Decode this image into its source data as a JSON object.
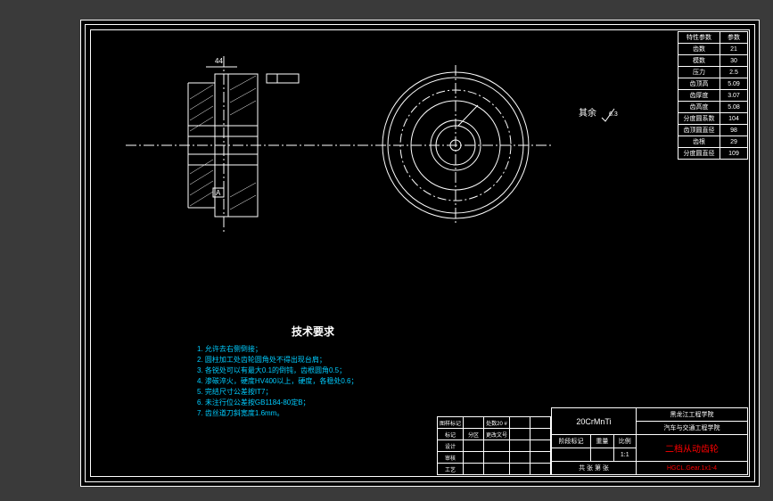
{
  "spec_table": {
    "header_left": "特性参数",
    "header_right": "参数",
    "rows": [
      {
        "label": "齿数",
        "value": "21"
      },
      {
        "label": "模数",
        "value": "30"
      },
      {
        "label": "压力",
        "value": "2.5"
      },
      {
        "label": "齿顶高",
        "value": "5.09"
      },
      {
        "label": "齿厚度",
        "value": "3.07"
      },
      {
        "label": "齿高度",
        "value": "5.08"
      },
      {
        "label": "分度圆系数",
        "value": "104"
      },
      {
        "label": "齿顶圆直径",
        "value": "98"
      },
      {
        "label": "齿根",
        "value": "29"
      },
      {
        "label": "分度圆直径",
        "value": "109"
      }
    ]
  },
  "surface": {
    "label": "其余",
    "symbol": "6.3"
  },
  "tech": {
    "title": "技术要求",
    "lines": [
      "1. 允许去右侧倒接；",
      "2. 圆柱加工处齿轮圆角处不得出现台肩；",
      "3. 各锐处可以有最大0.1的倒钝，齿根圆角0.5；",
      "4. 渗碳淬火，硬度HV400以上，硬度，各稳处0.6；",
      "5. 完结尺寸公差按IT7；",
      "6. 未注行位公差按GB1184-80定B；",
      "7. 齿丝道刀斜宽度1.6mm。"
    ]
  },
  "title_block": {
    "material": "20CrMnTi",
    "school": "黑龙江工程学院",
    "dept": "汽车与交通工程学院",
    "scale_label": "比例",
    "scale": "1:1",
    "part_name": "二档从动齿轮",
    "part_code": "HGCL.Gear.1x1-4",
    "row1_left": "图样标记",
    "row1_right": "处数20 #",
    "row2_left": "标记",
    "row2_mid": "分区",
    "row2_right": "更改文号",
    "row3_left": "设计",
    "row4_left": "审核",
    "row5_left": "工艺",
    "weight_label": "重量",
    "stage_label": "阶段标记",
    "sheet_label": "共 张 第  张"
  },
  "dims": {
    "d1": "44"
  }
}
